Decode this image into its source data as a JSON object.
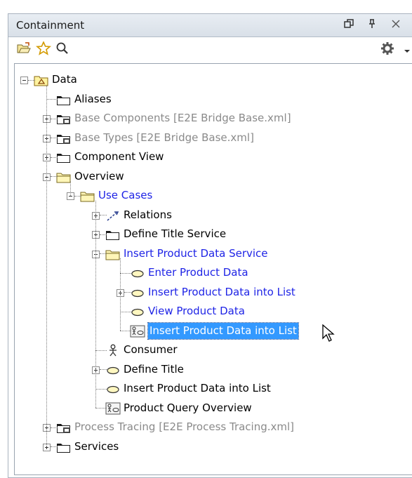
{
  "panel": {
    "title": "Containment",
    "titlebar_icons": [
      "restore-icon",
      "pin-icon",
      "close-icon"
    ]
  },
  "toolbar": {
    "tools": [
      "open-folder-icon",
      "favorite-star-icon",
      "search-icon",
      "gear-icon",
      "dropdown-arrow-icon"
    ]
  },
  "tree": {
    "root": {
      "label": "Data",
      "icon": "package-icon"
    },
    "items": [
      {
        "label": "Aliases",
        "icon": "folder-icon",
        "style": "normal"
      },
      {
        "label": "Base Components [E2E Bridge Base.xml]",
        "icon": "shared-folder-icon",
        "style": "gray"
      },
      {
        "label": "Base Types [E2E Bridge Base.xml]",
        "icon": "shared-folder-icon",
        "style": "gray"
      },
      {
        "label": "Component View",
        "icon": "folder-icon",
        "style": "normal"
      },
      {
        "label": "Overview",
        "icon": "open-folder-icon",
        "style": "normal"
      },
      {
        "label": "Use Cases",
        "icon": "open-folder-icon",
        "style": "blue"
      },
      {
        "label": "Relations",
        "icon": "relation-icon",
        "style": "normal"
      },
      {
        "label": "Define Title Service",
        "icon": "folder-icon",
        "style": "normal"
      },
      {
        "label": "Insert Product Data Service",
        "icon": "open-folder-icon",
        "style": "blue"
      },
      {
        "label": "Enter Product Data",
        "icon": "use-case-icon",
        "style": "blue"
      },
      {
        "label": "Insert Product Data into List",
        "icon": "use-case-icon",
        "style": "blue"
      },
      {
        "label": "View Product Data",
        "icon": "use-case-icon",
        "style": "blue"
      },
      {
        "label": "Insert Product Data into List",
        "icon": "diagram-icon",
        "style": "selected"
      },
      {
        "label": "Consumer",
        "icon": "actor-icon",
        "style": "normal"
      },
      {
        "label": "Define Title",
        "icon": "use-case-icon",
        "style": "normal"
      },
      {
        "label": "Insert Product Data into List",
        "icon": "use-case-icon",
        "style": "normal"
      },
      {
        "label": "Product Query Overview",
        "icon": "diagram-icon",
        "style": "normal"
      },
      {
        "label": "Process Tracing [E2E Process Tracing.xml]",
        "icon": "shared-folder-icon",
        "style": "gray"
      },
      {
        "label": "Services",
        "icon": "folder-icon",
        "style": "normal"
      }
    ]
  },
  "colors": {
    "selection": "#3399ff",
    "link_blue": "#1f24e6",
    "disabled_gray": "#8a8a8a",
    "folder_yellow": "#fff3b0"
  }
}
